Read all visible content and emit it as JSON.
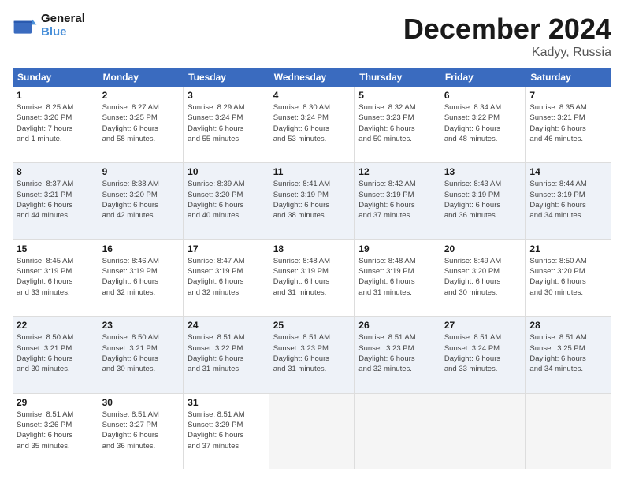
{
  "logo": {
    "line1": "General",
    "line2": "Blue"
  },
  "title": "December 2024",
  "subtitle": "Kadyy, Russia",
  "header_days": [
    "Sunday",
    "Monday",
    "Tuesday",
    "Wednesday",
    "Thursday",
    "Friday",
    "Saturday"
  ],
  "weeks": [
    [
      {
        "day": "1",
        "detail": "Sunrise: 8:25 AM\nSunset: 3:26 PM\nDaylight: 7 hours\nand 1 minute."
      },
      {
        "day": "2",
        "detail": "Sunrise: 8:27 AM\nSunset: 3:25 PM\nDaylight: 6 hours\nand 58 minutes."
      },
      {
        "day": "3",
        "detail": "Sunrise: 8:29 AM\nSunset: 3:24 PM\nDaylight: 6 hours\nand 55 minutes."
      },
      {
        "day": "4",
        "detail": "Sunrise: 8:30 AM\nSunset: 3:24 PM\nDaylight: 6 hours\nand 53 minutes."
      },
      {
        "day": "5",
        "detail": "Sunrise: 8:32 AM\nSunset: 3:23 PM\nDaylight: 6 hours\nand 50 minutes."
      },
      {
        "day": "6",
        "detail": "Sunrise: 8:34 AM\nSunset: 3:22 PM\nDaylight: 6 hours\nand 48 minutes."
      },
      {
        "day": "7",
        "detail": "Sunrise: 8:35 AM\nSunset: 3:21 PM\nDaylight: 6 hours\nand 46 minutes."
      }
    ],
    [
      {
        "day": "8",
        "detail": "Sunrise: 8:37 AM\nSunset: 3:21 PM\nDaylight: 6 hours\nand 44 minutes."
      },
      {
        "day": "9",
        "detail": "Sunrise: 8:38 AM\nSunset: 3:20 PM\nDaylight: 6 hours\nand 42 minutes."
      },
      {
        "day": "10",
        "detail": "Sunrise: 8:39 AM\nSunset: 3:20 PM\nDaylight: 6 hours\nand 40 minutes."
      },
      {
        "day": "11",
        "detail": "Sunrise: 8:41 AM\nSunset: 3:19 PM\nDaylight: 6 hours\nand 38 minutes."
      },
      {
        "day": "12",
        "detail": "Sunrise: 8:42 AM\nSunset: 3:19 PM\nDaylight: 6 hours\nand 37 minutes."
      },
      {
        "day": "13",
        "detail": "Sunrise: 8:43 AM\nSunset: 3:19 PM\nDaylight: 6 hours\nand 36 minutes."
      },
      {
        "day": "14",
        "detail": "Sunrise: 8:44 AM\nSunset: 3:19 PM\nDaylight: 6 hours\nand 34 minutes."
      }
    ],
    [
      {
        "day": "15",
        "detail": "Sunrise: 8:45 AM\nSunset: 3:19 PM\nDaylight: 6 hours\nand 33 minutes."
      },
      {
        "day": "16",
        "detail": "Sunrise: 8:46 AM\nSunset: 3:19 PM\nDaylight: 6 hours\nand 32 minutes."
      },
      {
        "day": "17",
        "detail": "Sunrise: 8:47 AM\nSunset: 3:19 PM\nDaylight: 6 hours\nand 32 minutes."
      },
      {
        "day": "18",
        "detail": "Sunrise: 8:48 AM\nSunset: 3:19 PM\nDaylight: 6 hours\nand 31 minutes."
      },
      {
        "day": "19",
        "detail": "Sunrise: 8:48 AM\nSunset: 3:19 PM\nDaylight: 6 hours\nand 31 minutes."
      },
      {
        "day": "20",
        "detail": "Sunrise: 8:49 AM\nSunset: 3:20 PM\nDaylight: 6 hours\nand 30 minutes."
      },
      {
        "day": "21",
        "detail": "Sunrise: 8:50 AM\nSunset: 3:20 PM\nDaylight: 6 hours\nand 30 minutes."
      }
    ],
    [
      {
        "day": "22",
        "detail": "Sunrise: 8:50 AM\nSunset: 3:21 PM\nDaylight: 6 hours\nand 30 minutes."
      },
      {
        "day": "23",
        "detail": "Sunrise: 8:50 AM\nSunset: 3:21 PM\nDaylight: 6 hours\nand 30 minutes."
      },
      {
        "day": "24",
        "detail": "Sunrise: 8:51 AM\nSunset: 3:22 PM\nDaylight: 6 hours\nand 31 minutes."
      },
      {
        "day": "25",
        "detail": "Sunrise: 8:51 AM\nSunset: 3:23 PM\nDaylight: 6 hours\nand 31 minutes."
      },
      {
        "day": "26",
        "detail": "Sunrise: 8:51 AM\nSunset: 3:23 PM\nDaylight: 6 hours\nand 32 minutes."
      },
      {
        "day": "27",
        "detail": "Sunrise: 8:51 AM\nSunset: 3:24 PM\nDaylight: 6 hours\nand 33 minutes."
      },
      {
        "day": "28",
        "detail": "Sunrise: 8:51 AM\nSunset: 3:25 PM\nDaylight: 6 hours\nand 34 minutes."
      }
    ],
    [
      {
        "day": "29",
        "detail": "Sunrise: 8:51 AM\nSunset: 3:26 PM\nDaylight: 6 hours\nand 35 minutes."
      },
      {
        "day": "30",
        "detail": "Sunrise: 8:51 AM\nSunset: 3:27 PM\nDaylight: 6 hours\nand 36 minutes."
      },
      {
        "day": "31",
        "detail": "Sunrise: 8:51 AM\nSunset: 3:29 PM\nDaylight: 6 hours\nand 37 minutes."
      },
      {
        "day": "",
        "detail": ""
      },
      {
        "day": "",
        "detail": ""
      },
      {
        "day": "",
        "detail": ""
      },
      {
        "day": "",
        "detail": ""
      }
    ]
  ]
}
